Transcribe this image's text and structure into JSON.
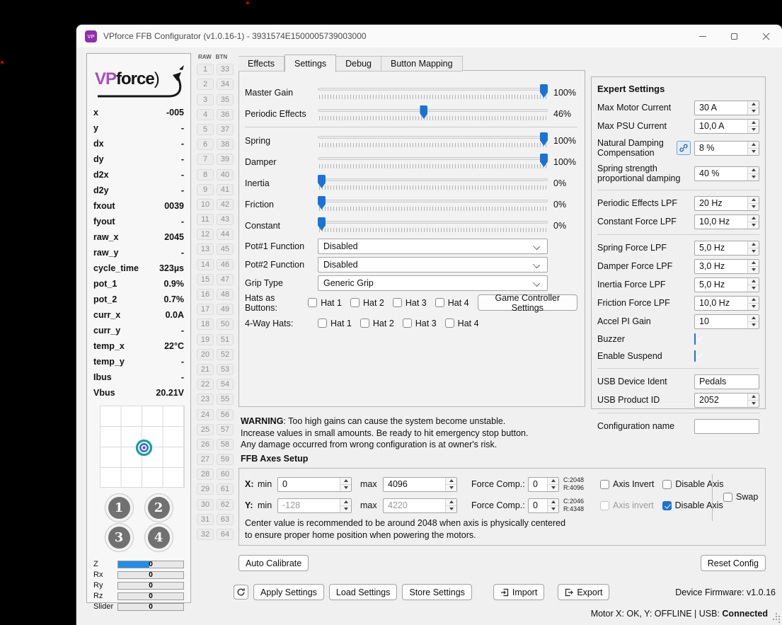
{
  "colors": {
    "accent": "#1a73d4",
    "zbar": "#1f8fe8",
    "logo-purple": "#a84cc0"
  },
  "window": {
    "title": "VPforce FFB Configurator (v1.0.16-1) - 3931574E1500005739003000",
    "icon_text": "VP"
  },
  "tabs": [
    {
      "label": "Effects",
      "active": false
    },
    {
      "label": "Settings",
      "active": true
    },
    {
      "label": "Debug",
      "active": false
    },
    {
      "label": "Button Mapping",
      "active": false
    }
  ],
  "sidebar": {
    "logo": {
      "vp": "VP",
      "force": "force",
      "paren": ")"
    },
    "telemetry": [
      {
        "label": "x",
        "value": "-005"
      },
      {
        "label": "y",
        "value": "-"
      },
      {
        "label": "dx",
        "value": "-"
      },
      {
        "label": "dy",
        "value": "-"
      },
      {
        "label": "d2x",
        "value": "-"
      },
      {
        "label": "d2y",
        "value": "-"
      },
      {
        "label": "fxout",
        "value": "0039"
      },
      {
        "label": "fyout",
        "value": "-"
      },
      {
        "label": "raw_x",
        "value": "2045"
      },
      {
        "label": "raw_y",
        "value": "-"
      },
      {
        "label": "cycle_time",
        "value": "323µs"
      },
      {
        "label": "pot_1",
        "value": "0.9%"
      },
      {
        "label": "pot_2",
        "value": "0.7%"
      },
      {
        "label": "curr_x",
        "value": "0.0A"
      },
      {
        "label": "curr_y",
        "value": "-"
      },
      {
        "label": "temp_x",
        "value": "22°C"
      },
      {
        "label": "temp_y",
        "value": "-"
      },
      {
        "label": "Ibus",
        "value": "-"
      },
      {
        "label": "Vbus",
        "value": "20.21V"
      }
    ],
    "pad_buttons": [
      {
        "label": "1"
      },
      {
        "label": "2"
      },
      {
        "label": "3"
      },
      {
        "label": "4"
      }
    ],
    "axes": [
      {
        "label": "Z",
        "value": "0",
        "fill": 48
      },
      {
        "label": "Rx",
        "value": "0",
        "fill": 0
      },
      {
        "label": "Ry",
        "value": "0",
        "fill": 0
      },
      {
        "label": "Rz",
        "value": "0",
        "fill": 0
      },
      {
        "label": "Slider",
        "value": "0",
        "fill": 0
      }
    ]
  },
  "raw_btn": {
    "raw_header": "RAW",
    "btn_header": "BTN",
    "rows": [
      {
        "raw": "1",
        "btn": "33"
      },
      {
        "raw": "2",
        "btn": "34"
      },
      {
        "raw": "3",
        "btn": "35"
      },
      {
        "raw": "4",
        "btn": "36"
      },
      {
        "raw": "5",
        "btn": "37"
      },
      {
        "raw": "6",
        "btn": "38"
      },
      {
        "raw": "7",
        "btn": "39"
      },
      {
        "raw": "8",
        "btn": "40"
      },
      {
        "raw": "9",
        "btn": "41"
      },
      {
        "raw": "10",
        "btn": "42"
      },
      {
        "raw": "11",
        "btn": "43"
      },
      {
        "raw": "12",
        "btn": "44"
      },
      {
        "raw": "13",
        "btn": "45"
      },
      {
        "raw": "14",
        "btn": "46"
      },
      {
        "raw": "15",
        "btn": "47"
      },
      {
        "raw": "16",
        "btn": "48"
      },
      {
        "raw": "17",
        "btn": "49"
      },
      {
        "raw": "18",
        "btn": "50"
      },
      {
        "raw": "19",
        "btn": "51"
      },
      {
        "raw": "20",
        "btn": "52"
      },
      {
        "raw": "21",
        "btn": "53"
      },
      {
        "raw": "22",
        "btn": "54"
      },
      {
        "raw": "23",
        "btn": "55"
      },
      {
        "raw": "24",
        "btn": "56"
      },
      {
        "raw": "25",
        "btn": "57"
      },
      {
        "raw": "26",
        "btn": "58"
      },
      {
        "raw": "27",
        "btn": "59"
      },
      {
        "raw": "28",
        "btn": "60"
      },
      {
        "raw": "29",
        "btn": "61"
      },
      {
        "raw": "30",
        "btn": "62"
      },
      {
        "raw": "31",
        "btn": "63"
      },
      {
        "raw": "32",
        "btn": "64"
      }
    ]
  },
  "settings_tab": {
    "sliders_main": [
      {
        "label": "Master Gain",
        "value": "100%",
        "pct": 100
      },
      {
        "label": "Periodic Effects",
        "value": "46%",
        "pct": 46
      }
    ],
    "sliders_effects": [
      {
        "label": "Spring",
        "value": "100%",
        "pct": 100
      },
      {
        "label": "Damper",
        "value": "100%",
        "pct": 100
      },
      {
        "label": "Inertia",
        "value": "0%",
        "pct": 0
      },
      {
        "label": "Friction",
        "value": "0%",
        "pct": 0
      },
      {
        "label": "Constant",
        "value": "0%",
        "pct": 0
      }
    ],
    "combos": [
      {
        "label": "Pot#1 Function",
        "value": "Disabled"
      },
      {
        "label": "Pot#2 Function",
        "value": "Disabled"
      },
      {
        "label": "Grip Type",
        "value": "Generic Grip"
      }
    ],
    "hats_as_buttons": {
      "label": "Hats as Buttons:",
      "items": [
        {
          "label": "Hat 1",
          "checked": false
        },
        {
          "label": "Hat 2",
          "checked": false
        },
        {
          "label": "Hat 3",
          "checked": false
        },
        {
          "label": "Hat 4",
          "checked": false
        }
      ],
      "button_label": "Game Controller Settings"
    },
    "four_way_hats": {
      "label": "4-Way Hats:",
      "items": [
        {
          "label": "Hat 1",
          "checked": false
        },
        {
          "label": "Hat 2",
          "checked": false
        },
        {
          "label": "Hat 3",
          "checked": false
        },
        {
          "label": "Hat 4",
          "checked": false
        }
      ]
    }
  },
  "expert": {
    "title": "Expert Settings",
    "group1": [
      {
        "label": "Max Motor Current",
        "value": "30 A"
      },
      {
        "label": "Max PSU Current",
        "value": "10,0 A"
      }
    ],
    "damping": {
      "label": "Natural Damping Compensation",
      "value": "8 %"
    },
    "spring_damping": {
      "label": "Spring strength proportional damping",
      "value": "40 %"
    },
    "group2": [
      {
        "label": "Periodic Effects LPF",
        "value": "20 Hz"
      },
      {
        "label": "Constant Force LPF",
        "value": "10,0 Hz"
      }
    ],
    "group3": [
      {
        "label": "Spring Force LPF",
        "value": "5,0 Hz"
      },
      {
        "label": "Damper Force LPF",
        "value": "3,0 Hz"
      },
      {
        "label": "Inertia Force LPF",
        "value": "5,0 Hz"
      },
      {
        "label": "Friction Force LPF",
        "value": "10,0 Hz"
      },
      {
        "label": "Accel PI Gain",
        "value": "10"
      }
    ],
    "checks": [
      {
        "label": "Buzzer",
        "checked": true
      },
      {
        "label": "Enable Suspend",
        "checked": true
      }
    ],
    "usb_ident": {
      "label": "USB Device Ident",
      "value": "Pedals"
    },
    "usb_pid": {
      "label": "USB Product ID",
      "value": "2052"
    },
    "config_name": {
      "label": "Configuration name",
      "value": ""
    }
  },
  "warning": {
    "bold": "WARNING",
    "line1": ": Too high gains can cause the system become unstable.",
    "line2": "Increase values in small amounts. Be ready to hit emergency stop button.",
    "line3": "Any damage occurred from wrong configuration is at owner's risk."
  },
  "ffb": {
    "title": "FFB Axes Setup",
    "rows": [
      {
        "axis": "X:",
        "min_label": "min",
        "min": "0",
        "max_label": "max",
        "max": "4096",
        "fc_label": "Force Comp.:",
        "fc": "0",
        "c": "C:2048",
        "r": "R:4096",
        "invert_label": "Axis Invert",
        "invert": false,
        "disable_label": "Disable Axis",
        "disable": false,
        "fields_disabled": false,
        "invert_disabled": false
      },
      {
        "axis": "Y:",
        "min_label": "min",
        "min": "-128",
        "max_label": "max",
        "max": "4220",
        "fc_label": "Force Comp.:",
        "fc": "0",
        "c": "C:2046",
        "r": "R:4348",
        "invert_label": "Axis invert",
        "invert": false,
        "disable_label": "Disable Axis",
        "disable": true,
        "fields_disabled": true,
        "invert_disabled": true
      }
    ],
    "swap_label": "Swap",
    "swap_checked": false,
    "note_line1": "Center value is recommended to be around 2048 when axis is physically centered",
    "note_line2": "to ensure proper home position when powering the motors."
  },
  "buttons": {
    "auto_calibrate": "Auto Calibrate",
    "reset_config": "Reset Config",
    "apply": "Apply Settings",
    "load": "Load Settings",
    "store": "Store Settings",
    "import": "Import",
    "export": "Export"
  },
  "footer": {
    "firmware": "Device Firmware: v1.0.16",
    "status_prefix": "Motor X: OK, Y: OFFLINE | USB: ",
    "status_bold": "Connected"
  }
}
